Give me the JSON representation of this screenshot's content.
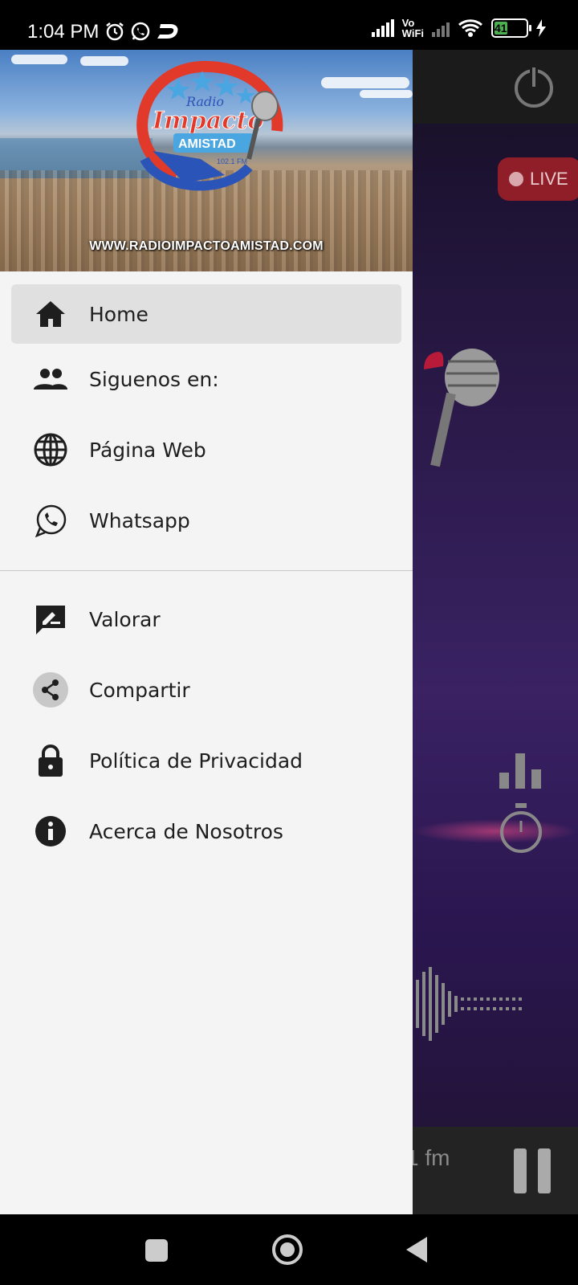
{
  "status_bar": {
    "time": "1:04 PM",
    "network_label_top": "Vo",
    "network_label_bottom": "WiFi",
    "battery": "41"
  },
  "background_app": {
    "live_label": "LIVE",
    "player_title": "1 fm"
  },
  "drawer": {
    "header_url": "WWW.RADIOIMPACTOAMISTAD.COM",
    "logo_text_top": "Radio",
    "logo_text_main": "Impacto",
    "logo_text_sub": "AMISTAD",
    "logo_freq": "102.1 FM",
    "items_primary": [
      {
        "label": "Home",
        "icon": "home-icon",
        "selected": true
      },
      {
        "label": "Siguenos en:",
        "icon": "people-icon"
      },
      {
        "label": "Página Web",
        "icon": "globe-icon"
      },
      {
        "label": "Whatsapp",
        "icon": "whatsapp-icon"
      }
    ],
    "items_secondary": [
      {
        "label": "Valorar",
        "icon": "rate-review-icon"
      },
      {
        "label": "Compartir",
        "icon": "share-icon"
      },
      {
        "label": "Política de Privacidad",
        "icon": "lock-icon"
      },
      {
        "label": "Acerca de Nosotros",
        "icon": "info-icon"
      }
    ]
  }
}
